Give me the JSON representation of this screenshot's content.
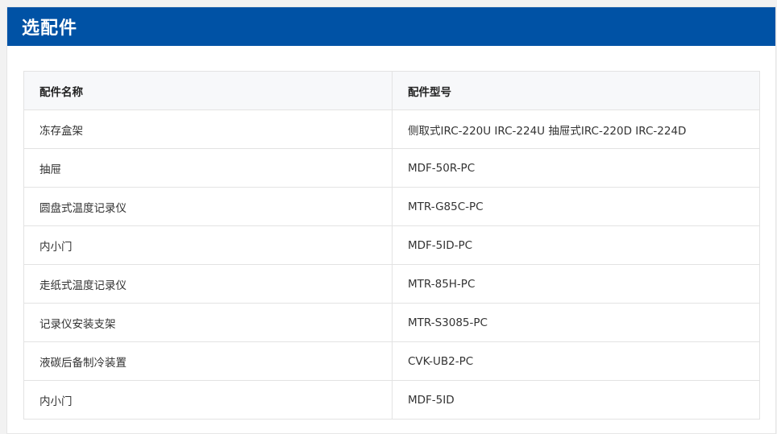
{
  "header": {
    "title": "选配件"
  },
  "table": {
    "columns": [
      "配件名称",
      "配件型号"
    ],
    "rows": [
      {
        "name": "冻存盒架",
        "model": "侧取式IRC-220U IRC-224U 抽屉式IRC-220D IRC-224D"
      },
      {
        "name": "抽屉",
        "model": "MDF-50R-PC"
      },
      {
        "name": "圆盘式温度记录仪",
        "model": "MTR-G85C-PC"
      },
      {
        "name": "内小门",
        "model": "MDF-5ID-PC"
      },
      {
        "name": "走纸式温度记录仪",
        "model": "MTR-85H-PC"
      },
      {
        "name": "记录仪安装支架",
        "model": "MTR-S3085-PC"
      },
      {
        "name": "液碳后备制冷装置",
        "model": "CVK-UB2-PC"
      },
      {
        "name": "内小门",
        "model": "MDF-5ID"
      }
    ]
  },
  "colors": {
    "header_bg": "#0052a5",
    "table_head_bg": "#f7f8fa"
  }
}
